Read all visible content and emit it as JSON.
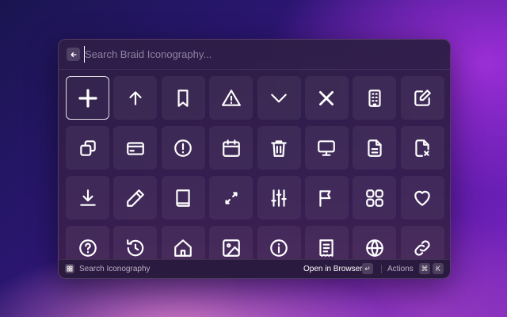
{
  "search": {
    "placeholder": "Search Braid Iconography...",
    "back_icon": "arrow-left-icon"
  },
  "grid": {
    "selected_index": 0,
    "icons": [
      "plus-icon",
      "arrow-up-icon",
      "bookmark-icon",
      "warning-icon",
      "chevron-down-icon",
      "close-icon",
      "building-icon",
      "edit-icon",
      "copy-icon",
      "credit-card-icon",
      "alert-circle-icon",
      "calendar-icon",
      "trash-icon",
      "monitor-icon",
      "document-icon",
      "file-remove-icon",
      "download-icon",
      "pencil-icon",
      "book-icon",
      "expand-icon",
      "sliders-icon",
      "flag-icon",
      "grid-icon",
      "heart-icon",
      "help-icon",
      "history-icon",
      "home-icon",
      "image-icon",
      "info-icon",
      "receipt-icon",
      "globe-icon",
      "link-icon"
    ]
  },
  "footer": {
    "logo_icon": "braid-logo-icon",
    "title": "Search Iconography",
    "primary_action": "Open in Browser",
    "enter_key": "↵",
    "actions_label": "Actions",
    "cmd_key": "⌘",
    "k_key": "K"
  }
}
